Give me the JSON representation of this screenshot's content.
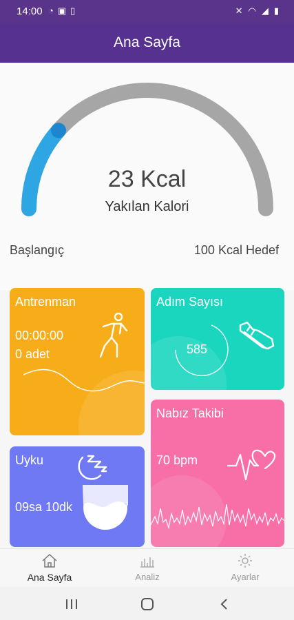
{
  "status_bar": {
    "time": "14:00"
  },
  "app_bar": {
    "title": "Ana Sayfa"
  },
  "gauge": {
    "value_text": "23 Kcal",
    "label": "Yakılan Kalori",
    "start_label": "Başlangıç",
    "end_label": "100 Kcal Hedef",
    "progress": 0.23,
    "track_color": "#a6a6a6",
    "progress_color": "#2ea6e3",
    "thumb_color": "#1d86cf"
  },
  "cards": {
    "training": {
      "title": "Antrenman",
      "time": "00:00:00",
      "count": "0 adet",
      "color": "#f7ad1a"
    },
    "steps": {
      "title": "Adım Sayısı",
      "value": "585",
      "color": "#1ad6bf"
    },
    "sleep": {
      "title": "Uyku",
      "value": "09sa 10dk",
      "color": "#6f79f3"
    },
    "pulse": {
      "title": "Nabız Takibi",
      "value": "70 bpm",
      "color": "#f76fa6"
    }
  },
  "bottom_nav": {
    "home": "Ana Sayfa",
    "analysis": "Analiz",
    "settings": "Ayarlar"
  },
  "icons": [
    "whatsapp-icon",
    "app-icon",
    "battery-saver-icon",
    "mute-icon",
    "wifi-icon",
    "signal-icon",
    "battery-icon",
    "running-figure-icon",
    "shoe-icon",
    "moon-icon",
    "sleep-wave-icon",
    "heart-pulse-icon",
    "home-icon",
    "chart-icon",
    "gear-icon"
  ]
}
